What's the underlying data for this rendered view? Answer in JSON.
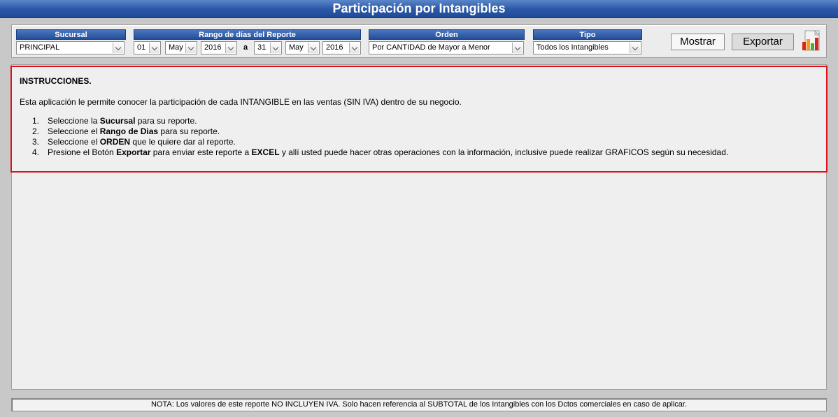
{
  "window": {
    "title": "Participación por Intangibles"
  },
  "toolbar": {
    "sucursal": {
      "label": "Sucursal",
      "value": "PRINCIPAL"
    },
    "rango": {
      "label": "Rango de días del Reporte",
      "from_day": "01",
      "from_month": "May",
      "from_year": "2016",
      "separator": "a",
      "to_day": "31",
      "to_month": "May",
      "to_year": "2016"
    },
    "orden": {
      "label": "Orden",
      "value": "Por CANTIDAD de Mayor a Menor"
    },
    "tipo": {
      "label": "Tipo",
      "value": "Todos los Intangibles"
    },
    "mostrar_label": "Mostrar",
    "exportar_label": "Exportar",
    "export_icon": "excel-chart-icon"
  },
  "instructions": {
    "title": "INSTRUCCIONES.",
    "description": "Esta aplicación le permite conocer la participación de cada INTANGIBLE en las ventas (SIN IVA) dentro de su negocio.",
    "steps": [
      {
        "num": "1.",
        "pre": "Seleccione la ",
        "bold": "Sucursal",
        "post": " para su reporte."
      },
      {
        "num": "2.",
        "pre": "Seleccione el ",
        "bold": "Rango de Dias",
        "post": " para su reporte."
      },
      {
        "num": "3.",
        "pre": "Seleccione el ",
        "bold": "ORDEN",
        "post": " que le quiere dar al reporte."
      },
      {
        "num": "4.",
        "pre": "Presione el Botón ",
        "bold": "Exportar",
        "post": " para enviar este reporte a ",
        "bold2": "EXCEL",
        "post2": " y allí usted puede hacer otras operaciones con la información, inclusive puede realizar GRAFICOS según su necesidad."
      }
    ],
    "border_color": "#e0101a"
  },
  "footer": {
    "note": "NOTA: Los valores de este reporte NO INCLUYEN IVA. Solo hacen referencia al SUBTOTAL de los Intangibles con los Dctos comerciales en caso de aplicar."
  },
  "colors": {
    "header_blue": "#2c5aa8",
    "background": "#c8c8c8",
    "panel": "#efefef"
  }
}
